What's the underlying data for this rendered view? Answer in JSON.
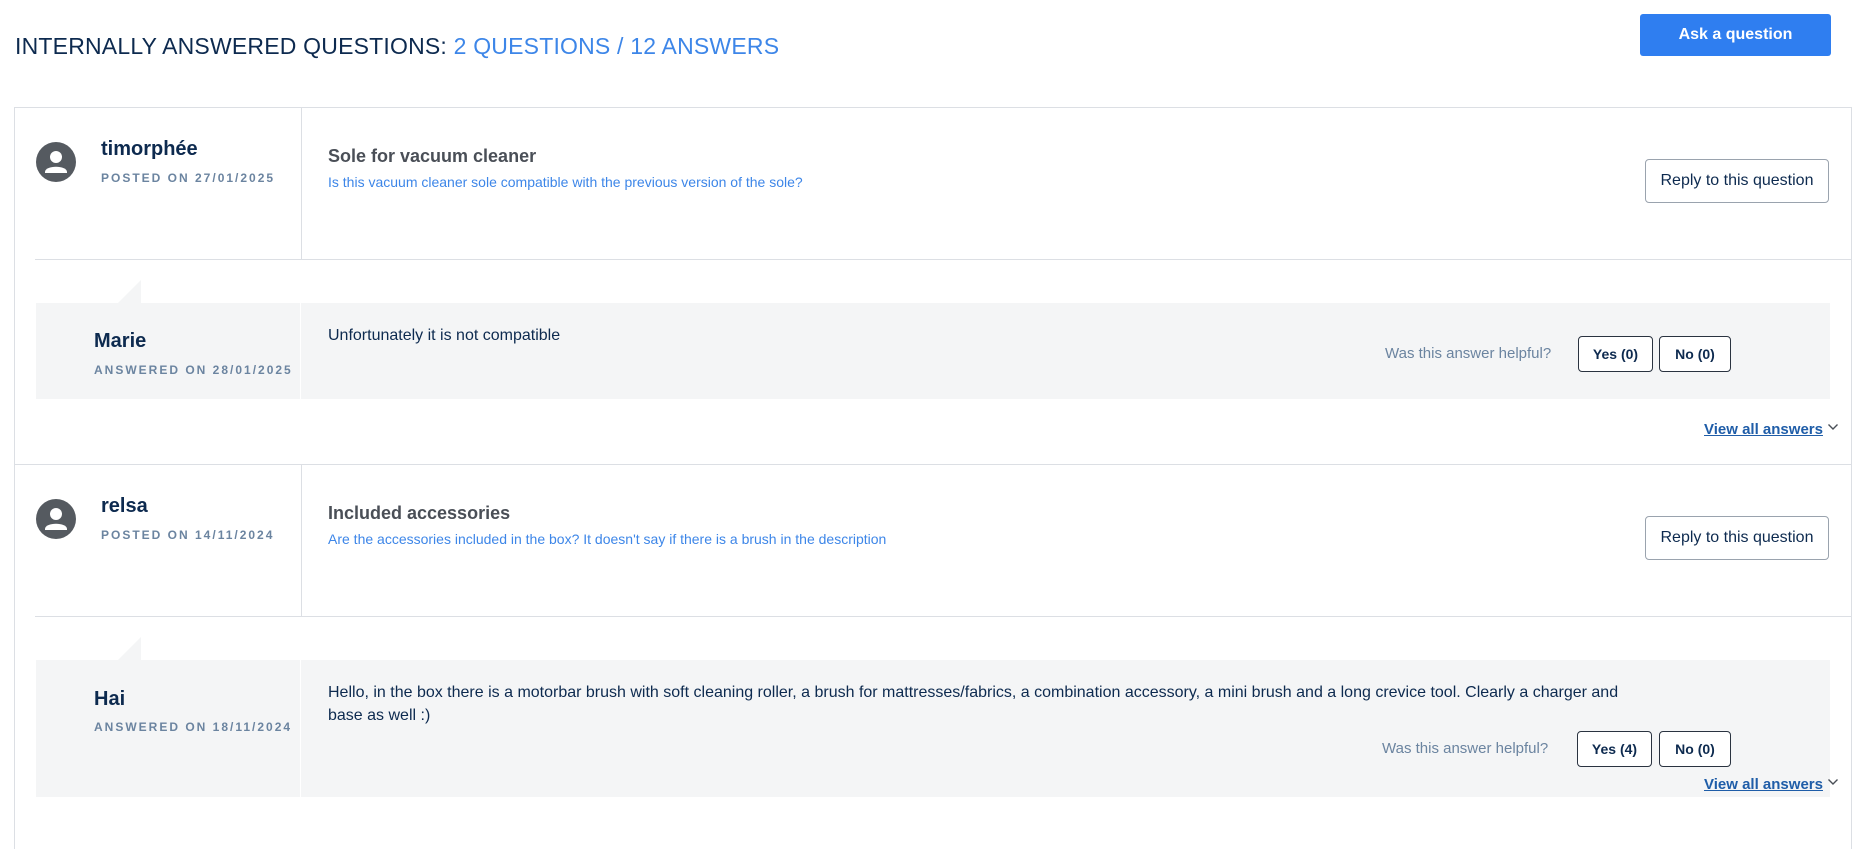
{
  "header": {
    "title": "INTERNALLY ANSWERED QUESTIONS:",
    "counts": "2 QUESTIONS / 12 ANSWERS",
    "ask_button": "Ask a question"
  },
  "questions": [
    {
      "user": "timorphée",
      "posted": "POSTED ON 27/01/2025",
      "title": "Sole for vacuum cleaner",
      "body": "Is this vacuum cleaner sole compatible with the previous version of the sole?",
      "reply_button": "Reply to this question",
      "answer": {
        "author": "Marie",
        "answered": "ANSWERED ON 28/01/2025",
        "text": "Unfortunately it is not compatible",
        "helpful_label": "Was this answer helpful?",
        "yes": "Yes (0)",
        "no": "No (0)"
      },
      "view_all": "View all answers"
    },
    {
      "user": "relsa",
      "posted": "POSTED ON 14/11/2024",
      "title": "Included accessories",
      "body": "Are the accessories included in the box? It doesn't say if there is a brush in the description",
      "reply_button": "Reply to this question",
      "answer": {
        "author": "Hai",
        "answered": "ANSWERED ON 18/11/2024",
        "text": "Hello, in the box there is a motorbar brush with soft cleaning roller, a brush for mattresses/fabrics, a combination accessory, a mini brush and a long crevice tool. Clearly a charger and base as well :)",
        "helpful_label": "Was this answer helpful?",
        "yes": "Yes (4)",
        "no": "No (0)"
      },
      "view_all": "View all answers"
    }
  ],
  "icons": {
    "avatar": "user-avatar-icon",
    "chevron": "chevron-down-icon"
  },
  "colors": {
    "primary": "#2f7ef0",
    "accent_text": "#3d86e8",
    "heading": "#0d2a4f",
    "muted": "#6b84a0",
    "answer_bg": "#f4f5f6"
  }
}
